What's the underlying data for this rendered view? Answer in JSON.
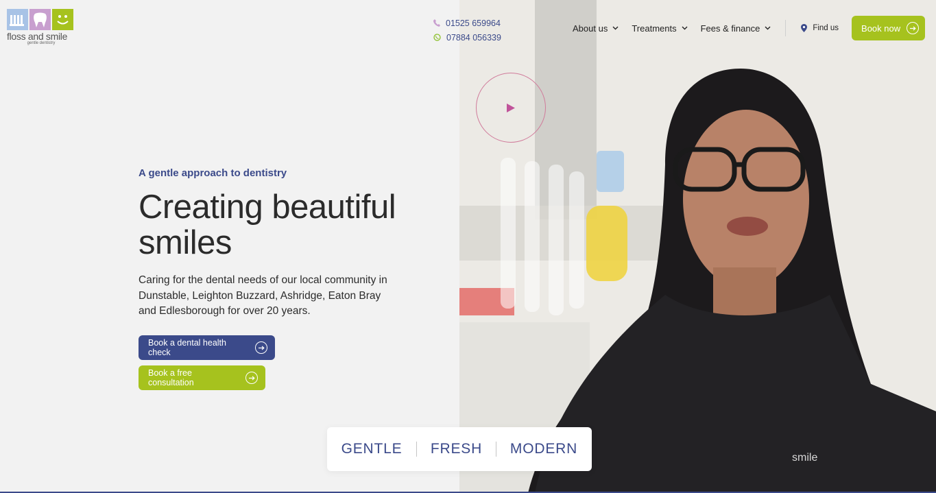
{
  "brand": {
    "name": "floss and smile",
    "tagline": "gentle dentistry"
  },
  "contact": {
    "phone": "01525 659964",
    "whatsapp": "07884 056339"
  },
  "nav": {
    "items": [
      {
        "label": "About us"
      },
      {
        "label": "Treatments"
      },
      {
        "label": "Fees & finance"
      }
    ],
    "find_us": "Find us",
    "book_now": "Book now"
  },
  "hero": {
    "eyebrow": "A gentle approach to dentistry",
    "headline": "Creating beautiful smiles",
    "body": "Caring for the dental needs of our local community in Dunstable, Leighton Buzzard, Ashridge, Eaton Bray and Edlesborough for over 20 years.",
    "cta_primary": "Book a dental health check",
    "cta_secondary": "Book a free consultation"
  },
  "values": [
    "GENTLE",
    "FRESH",
    "MODERN"
  ],
  "colors": {
    "navy": "#3b4a8a",
    "lime": "#a6c21e",
    "pink": "#c89fcf",
    "blue": "#a8c3e6"
  }
}
